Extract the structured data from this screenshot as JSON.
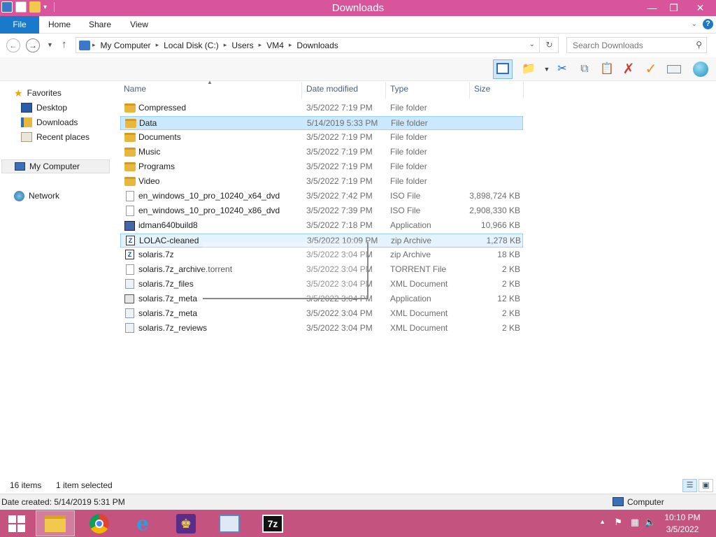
{
  "window": {
    "title": "Downloads"
  },
  "ribbon": {
    "tabs": [
      "File",
      "Home",
      "Share",
      "View"
    ],
    "help": "?"
  },
  "address": {
    "crumbs": [
      "My Computer",
      "Local Disk (C:)",
      "Users",
      "VM4",
      "Downloads"
    ],
    "search_placeholder": "Search Downloads"
  },
  "nav": {
    "favorites": "Favorites",
    "desktop": "Desktop",
    "downloads": "Downloads",
    "recent": "Recent places",
    "computer": "My Computer",
    "network": "Network"
  },
  "columns": {
    "name": "Name",
    "date": "Date modified",
    "type": "Type",
    "size": "Size"
  },
  "files": [
    {
      "name": "Compressed",
      "date": "3/5/2022 7:19 PM",
      "type": "File folder",
      "size": "",
      "icon": "folder-icon"
    },
    {
      "name": "Data",
      "date": "5/14/2019 5:33 PM",
      "type": "File folder",
      "size": "",
      "icon": "folder-icon",
      "selected": true
    },
    {
      "name": "Documents",
      "date": "3/5/2022 7:19 PM",
      "type": "File folder",
      "size": "",
      "icon": "folder-icon"
    },
    {
      "name": "Music",
      "date": "3/5/2022 7:19 PM",
      "type": "File folder",
      "size": "",
      "icon": "folder-icon"
    },
    {
      "name": "Programs",
      "date": "3/5/2022 7:19 PM",
      "type": "File folder",
      "size": "",
      "icon": "folder-icon"
    },
    {
      "name": "Video",
      "date": "3/5/2022 7:19 PM",
      "type": "File folder",
      "size": "",
      "icon": "folder-icon"
    },
    {
      "name": "en_windows_10_pro_10240_x64_dvd",
      "date": "3/5/2022 7:42 PM",
      "type": "ISO File",
      "size": "3,898,724 KB",
      "icon": "iso-file-icon"
    },
    {
      "name": "en_windows_10_pro_10240_x86_dvd",
      "date": "3/5/2022 7:39 PM",
      "type": "ISO File",
      "size": "2,908,330 KB",
      "icon": "iso-file-icon"
    },
    {
      "name": "idman640build8",
      "date": "3/5/2022 7:18 PM",
      "type": "Application",
      "size": "10,966 KB",
      "icon": "installer-icon"
    },
    {
      "name": "LOLAC-cleaned",
      "date": "3/5/2022 10:09 PM",
      "type": "zip Archive",
      "size": "1,278 KB",
      "icon": "zip-icon",
      "hover": true
    },
    {
      "name": "solaris.7z",
      "date": "3/5/2022 3:04 PM",
      "type": "zip Archive",
      "size": "18 KB",
      "icon": "zip-icon"
    },
    {
      "name": "solaris.7z_archive.torrent",
      "date": "3/5/2022 3:04 PM",
      "type": "TORRENT File",
      "size": "2 KB",
      "icon": "blank-file-icon"
    },
    {
      "name": "solaris.7z_files",
      "date": "3/5/2022 3:04 PM",
      "type": "XML Document",
      "size": "2 KB",
      "icon": "xml-file-icon"
    },
    {
      "name": "solaris.7z_meta",
      "date": "3/5/2022 3:04 PM",
      "type": "Application",
      "size": "12 KB",
      "icon": "app-window-icon"
    },
    {
      "name": "solaris.7z_meta",
      "date": "3/5/2022 3:04 PM",
      "type": "XML Document",
      "size": "2 KB",
      "icon": "xml-file-icon"
    },
    {
      "name": "solaris.7z_reviews",
      "date": "3/5/2022 3:04 PM",
      "type": "XML Document",
      "size": "2 KB",
      "icon": "xml-file-icon"
    }
  ],
  "status": {
    "count": "16 items",
    "selected": "1 item selected"
  },
  "details": {
    "created": "Date created: 5/14/2019 5:31 PM",
    "location": "Computer"
  },
  "clock": {
    "time": "10:10 PM",
    "date": "3/5/2022"
  },
  "taskbar_apps": [
    "file-explorer-icon",
    "chrome-icon",
    "internet-explorer-icon",
    "trophy-icon",
    "control-panel-icon",
    "7zip-icon"
  ],
  "colors": {
    "titlebar": "#d9559b",
    "taskbar": "#c4537f",
    "accent": "#1979ca",
    "selection": "#cce8ff"
  },
  "sort": {
    "column": "Name",
    "direction": "ascending"
  },
  "view_mode": "details"
}
